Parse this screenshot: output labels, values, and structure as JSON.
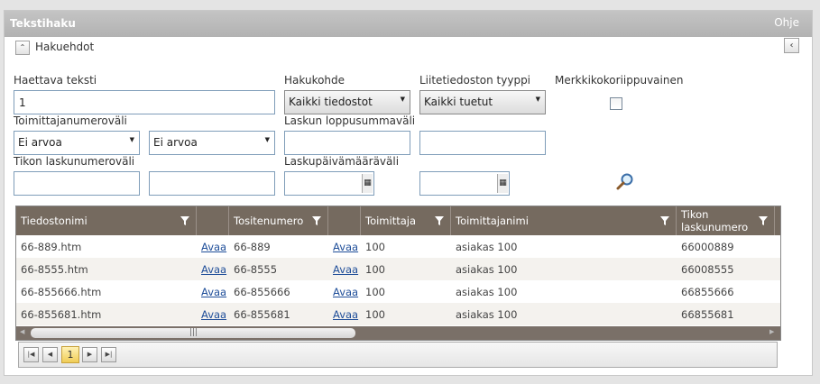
{
  "window": {
    "title": "Tekstihaku",
    "help": "Ohje",
    "collapse_right": "‹"
  },
  "criteria": {
    "toggle": "⌃",
    "title": "Hakuehdot"
  },
  "form": {
    "search_text": {
      "label": "Haettava teksti",
      "value": "1"
    },
    "target": {
      "label": "Hakukohde",
      "value": "Kaikki tiedostot"
    },
    "attachment_type": {
      "label": "Liitetiedoston tyyppi",
      "value": "Kaikki tuetut"
    },
    "case_sensitive": {
      "label": "Merkkikokoriippuvainen",
      "checked": false
    },
    "supplier_range": {
      "label": "Toimittajanumeroväli",
      "from": "Ei arvoa",
      "to": "Ei arvoa"
    },
    "invoice_sum_range": {
      "label": "Laskun loppusummaväli",
      "from": "",
      "to": ""
    },
    "tikon_invoice_range": {
      "label": "Tikon laskunumeroväli",
      "from": "",
      "to": ""
    },
    "invoice_date_range": {
      "label": "Laskupäivämääräväli",
      "from": "",
      "to": ""
    }
  },
  "grid": {
    "columns": [
      "Tiedostonimi",
      "",
      "Tositenumero",
      "",
      "Toimittaja",
      "Toimittajanimi",
      "Tikon laskunumero"
    ],
    "link_label": "Avaa",
    "rows": [
      {
        "file": "66-889.htm",
        "voucher": "66-889",
        "supplier": "100",
        "supplier_name": "asiakas 100",
        "tikon_no": "66000889"
      },
      {
        "file": "66-8555.htm",
        "voucher": "66-8555",
        "supplier": "100",
        "supplier_name": "asiakas 100",
        "tikon_no": "66008555"
      },
      {
        "file": "66-855666.htm",
        "voucher": "66-855666",
        "supplier": "100",
        "supplier_name": "asiakas 100",
        "tikon_no": "66855666"
      },
      {
        "file": "66-855681.htm",
        "voucher": "66-855681",
        "supplier": "100",
        "supplier_name": "asiakas 100",
        "tikon_no": "66855681"
      }
    ]
  },
  "pager": {
    "current_page": "1"
  },
  "colors": {
    "header_bg": "#756a5f",
    "link": "#1f4e99",
    "current_page_bg": "#f0cd57"
  }
}
